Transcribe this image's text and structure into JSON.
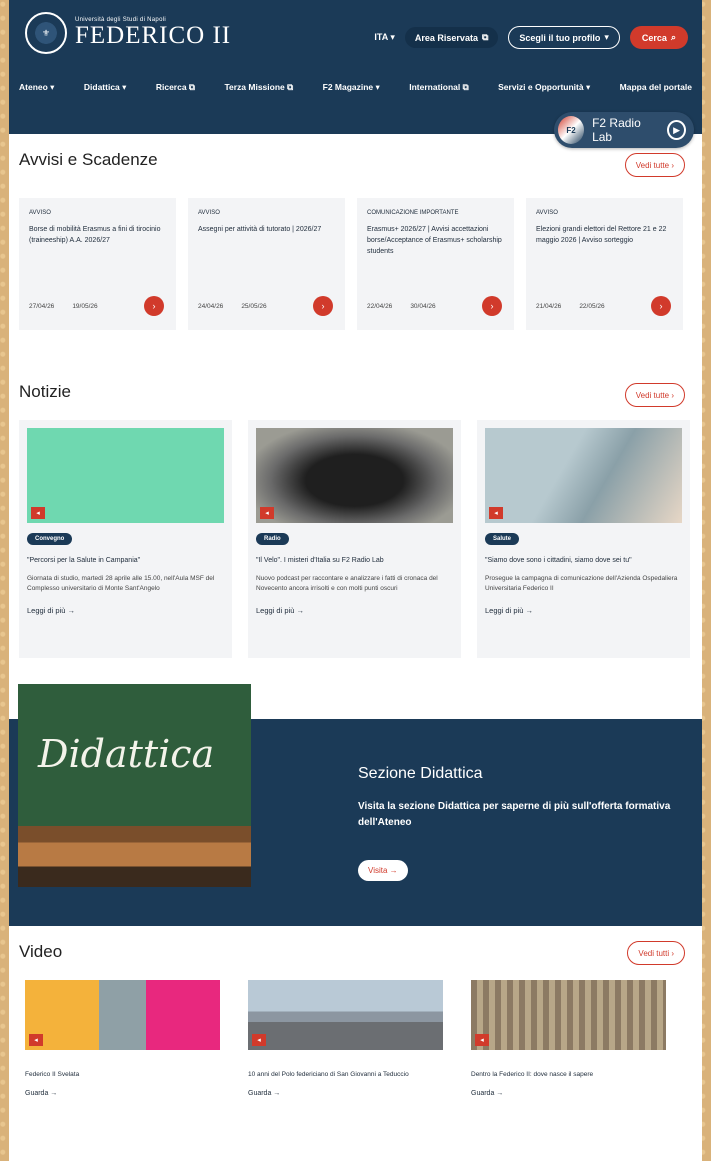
{
  "header": {
    "logo_small": "Università degli Studi di Napoli",
    "logo_big": "FEDERICO II",
    "lang": "ITA ▾",
    "area_riservata": "Area Riservata",
    "scegli_profilo": "Scegli il tuo profilo",
    "cerca": "Cerca",
    "nav": [
      "Ateneo ▾",
      "Didattica ▾",
      "Ricerca ⧉",
      "Terza Missione ⧉",
      "F2 Magazine ▾",
      "International ⧉",
      "Servizi e Opportunità ▾",
      "Mappa del portale"
    ],
    "radio": "F2 Radio Lab"
  },
  "avvisi": {
    "title": "Avvisi e Scadenze",
    "vedi": "Vedi tutte ›",
    "items": [
      {
        "tag": "AVVISO",
        "text": "Borse di mobilità Erasmus a fini di tirocinio (traineeship) A.A. 2026/27",
        "d1": "27/04/26",
        "d2": "19/05/26"
      },
      {
        "tag": "AVVISO",
        "text": "Assegni per attività di tutorato | 2026/27",
        "d1": "24/04/26",
        "d2": "25/05/26"
      },
      {
        "tag": "COMUNICAZIONE IMPORTANTE",
        "text": "Erasmus+ 2026/27 | Avvisi accettazioni borse/Acceptance of Erasmus+ scholarship students",
        "d1": "22/04/26",
        "d2": "30/04/26"
      },
      {
        "tag": "AVVISO",
        "text": "Elezioni grandi elettori del Rettore 21 e 22 maggio 2026 | Avviso sorteggio",
        "d1": "21/04/26",
        "d2": "22/05/26"
      }
    ]
  },
  "notizie": {
    "title": "Notizie",
    "vedi": "Vedi tutte ›",
    "items": [
      {
        "badge": "Convegno",
        "title": "\"Percorsi per la Salute in Campania\"",
        "desc": "Giornata di studio, martedì 28 aprile alle 15.00, nell'Aula MSF del Complesso universitario di Monte Sant'Angelo",
        "more": "Leggi di più →"
      },
      {
        "badge": "Radio",
        "title": "\"Il Velo\". I misteri d'Italia su F2 Radio Lab",
        "desc": "Nuovo podcast per raccontare e analizzare i fatti di cronaca del Novecento ancora irrisolti e con molti punti oscuri",
        "more": "Leggi di più →"
      },
      {
        "badge": "Salute",
        "title": "\"Siamo dove sono i cittadini, siamo dove sei tu\"",
        "desc": "Prosegue la campagna di comunicazione dell'Azienda Ospedaliera Universitaria Federico II",
        "more": "Leggi di più →"
      }
    ]
  },
  "didattica": {
    "image_word": "Didattica",
    "title": "Sezione Didattica",
    "text": "Visita la sezione Didattica per saperne di più sull'offerta formativa dell'Ateneo",
    "button": "Visita →"
  },
  "video": {
    "title": "Video",
    "vedi": "Vedi tutti ›",
    "items": [
      {
        "title": "Federico II Svelata",
        "more": "Guarda →"
      },
      {
        "title": "10 anni del Polo federiciano di San Giovanni a Teduccio",
        "more": "Guarda →"
      },
      {
        "title": "Dentro la Federico II: dove nasce il sapere",
        "more": "Guarda →"
      }
    ]
  },
  "colors": {
    "primary": "#1b3a57",
    "accent": "#d13a2b"
  }
}
